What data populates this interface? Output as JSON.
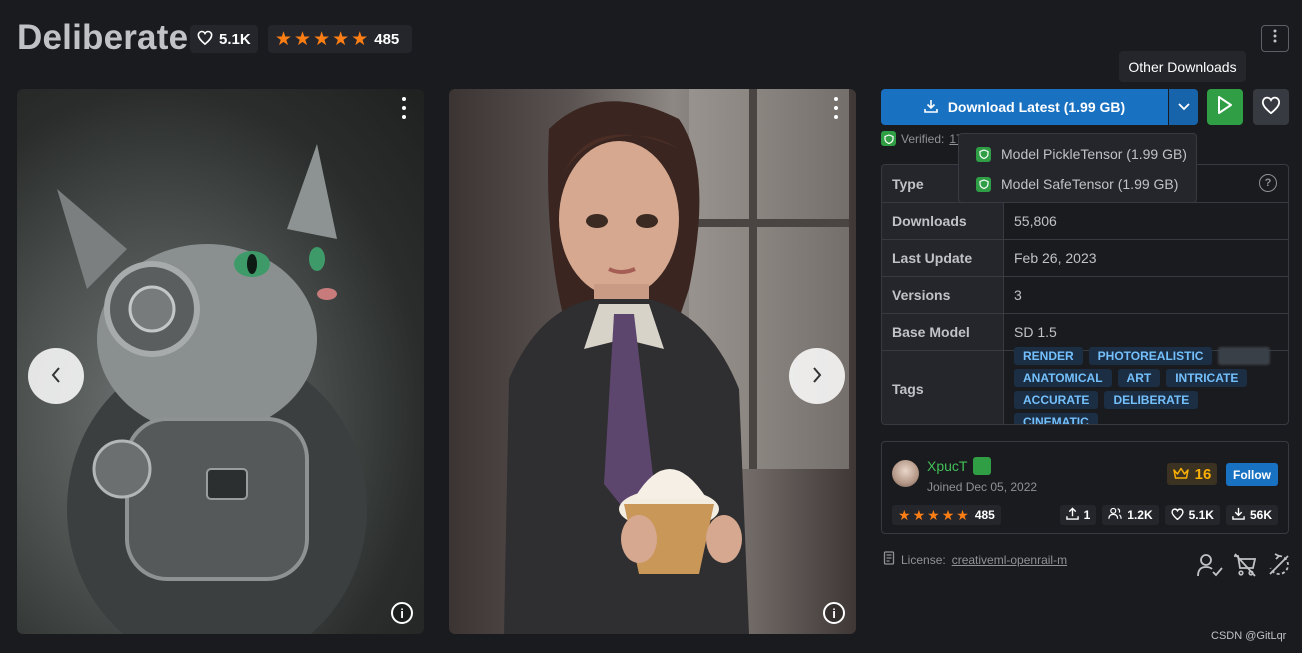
{
  "header": {
    "title": "Deliberate",
    "likes": "5.1K",
    "rating_count": "485",
    "stars": 5
  },
  "tooltip": "Other Downloads",
  "download": {
    "label": "Download Latest (1.99 GB)",
    "verified_prefix": "Verified:",
    "verified_link": "17",
    "options": [
      "Model PickleTensor (1.99 GB)",
      "Model SafeTensor (1.99 GB)"
    ]
  },
  "details": {
    "rows": [
      {
        "key": "Type",
        "value": ""
      },
      {
        "key": "Downloads",
        "value": "55,806"
      },
      {
        "key": "Last Update",
        "value": "Feb 26, 2023"
      },
      {
        "key": "Versions",
        "value": "3"
      },
      {
        "key": "Base Model",
        "value": "SD 1.5"
      }
    ],
    "tags_label": "Tags",
    "tags": [
      "RENDER",
      "PHOTOREALISTIC",
      "ANATOMICAL",
      "ART",
      "INTRICATE",
      "ACCURATE",
      "DELIBERATE",
      "CINEMATIC"
    ]
  },
  "creator": {
    "name": "XpucT",
    "joined": "Joined Dec 05, 2022",
    "rank": "16",
    "follow_label": "Follow",
    "rating_count": "485",
    "uploads": "1",
    "followers": "1.2K",
    "likes": "5.1K",
    "downloads": "56K"
  },
  "license": {
    "prefix": "License:",
    "link": "creativeml-openrail-m"
  },
  "watermark": "CSDN @GitLqr",
  "colors": {
    "background": "#1a1b1e",
    "primary": "#1971c2",
    "success": "#2f9e44",
    "star": "#fd7e14",
    "tag_text": "#74c0fc"
  }
}
